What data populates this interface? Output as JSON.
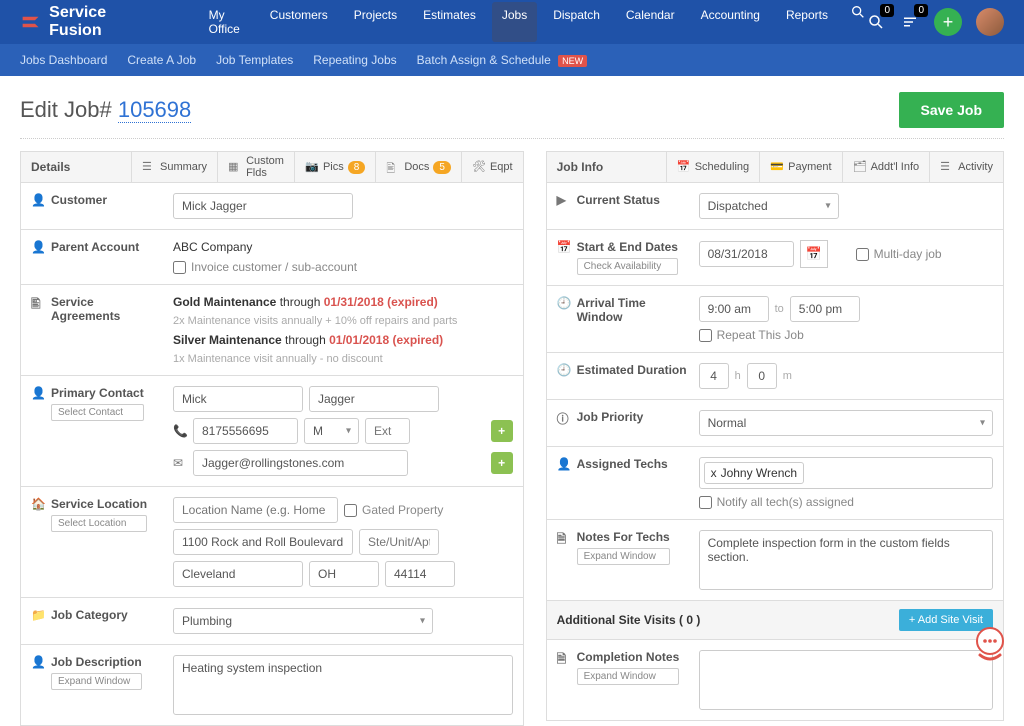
{
  "brand": "Service Fusion",
  "topnav": {
    "items": [
      "My Office",
      "Customers",
      "Projects",
      "Estimates",
      "Jobs",
      "Dispatch",
      "Calendar",
      "Accounting",
      "Reports"
    ],
    "active_index": 4,
    "badge_search": "0",
    "badge_list": "0"
  },
  "subnav": {
    "items": [
      "Jobs Dashboard",
      "Create A Job",
      "Job Templates",
      "Repeating Jobs",
      "Batch Assign & Schedule"
    ],
    "new_badge": "NEW"
  },
  "page": {
    "title_prefix": "Edit Job# ",
    "job_number": "105698",
    "save_label": "Save Job"
  },
  "details_panel": {
    "title": "Details",
    "tabs": {
      "summary": "Summary",
      "custom": "Custom Flds",
      "pics": "Pics",
      "pics_count": "8",
      "docs": "Docs",
      "docs_count": "5",
      "eqpt": "Eqpt"
    },
    "customer": {
      "label": "Customer",
      "value": "Mick Jagger"
    },
    "parent_account": {
      "label": "Parent Account",
      "company": "ABC Company",
      "invoice_checkbox": "Invoice customer / sub-account"
    },
    "service_agreements": {
      "label": "Service Agreements",
      "gold_name": "Gold Maintenance",
      "gold_through": " through ",
      "gold_date": "01/31/2018 (expired)",
      "gold_desc": "2x Maintenance visits annually + 10% off repairs and parts",
      "silver_name": "Silver Maintenance",
      "silver_through": " through ",
      "silver_date": "01/01/2018 (expired)",
      "silver_desc": "1x Maintenance visit annually - no discount"
    },
    "primary_contact": {
      "label": "Primary Contact",
      "sub": "Select Contact",
      "first": "Mick",
      "last": "Jagger",
      "phone": "8175556695",
      "phone_type": "M",
      "ext_ph": "Ext",
      "email": "Jagger@rollingstones.com"
    },
    "service_location": {
      "label": "Service Location",
      "sub": "Select Location",
      "name_ph": "Location Name (e.g. Home or O",
      "gated": "Gated Property",
      "street": "1100 Rock and Roll Boulevard",
      "unit_ph": "Ste/Unit/Apt",
      "city": "Cleveland",
      "state": "OH",
      "zip": "44114"
    },
    "job_category": {
      "label": "Job Category",
      "value": "Plumbing"
    },
    "job_description": {
      "label": "Job Description",
      "sub": "Expand Window",
      "value": "Heating system inspection"
    }
  },
  "jobinfo_panel": {
    "title": "Job Info",
    "tabs": {
      "scheduling": "Scheduling",
      "payment": "Payment",
      "addtl": "Addt'l Info",
      "activity": "Activity"
    },
    "status": {
      "label": "Current Status",
      "value": "Dispatched"
    },
    "dates": {
      "label": "Start & End Dates",
      "sub": "Check Availability",
      "date": "08/31/2018",
      "multiday": "Multi-day job"
    },
    "arrival": {
      "label": "Arrival Time Window",
      "from": "9:00 am",
      "to_label": "to",
      "to": "5:00 pm",
      "repeat": "Repeat This Job"
    },
    "duration": {
      "label": "Estimated Duration",
      "hours": "4",
      "h_label": "h",
      "mins": "0",
      "m_label": "m"
    },
    "priority": {
      "label": "Job Priority",
      "value": "Normal"
    },
    "assigned": {
      "label": "Assigned Techs",
      "chip_x": "x",
      "chip": "Johny Wrench",
      "notify": "Notify all tech(s) assigned"
    },
    "notes_techs": {
      "label": "Notes For Techs",
      "sub": "Expand Window",
      "value": "Complete inspection form in the custom fields section."
    },
    "visits": {
      "title": "Additional Site Visits ( 0 )",
      "add_btn": "+ Add Site Visit"
    },
    "completion": {
      "label": "Completion Notes",
      "sub": "Expand Window"
    }
  }
}
